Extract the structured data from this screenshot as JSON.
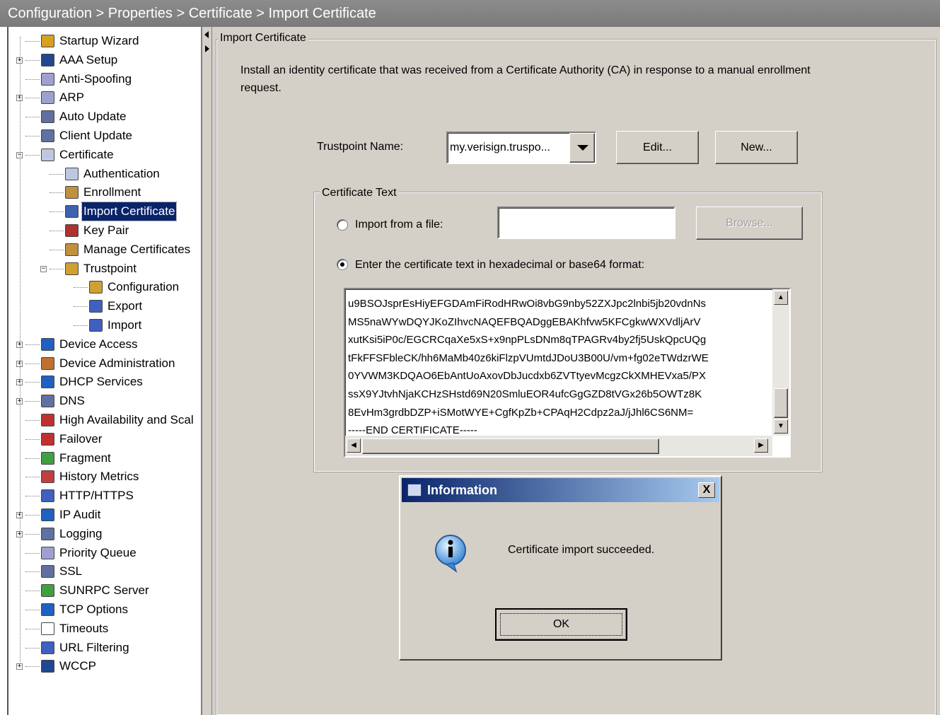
{
  "breadcrumb": "Configuration > Properties > Certificate > Import Certificate",
  "tree": [
    {
      "label": "Startup Wizard",
      "icon": "wizard-icon",
      "depth": 0,
      "expander": "",
      "color": "#d8a020"
    },
    {
      "label": "AAA Setup",
      "icon": "lock-icon",
      "depth": 0,
      "expander": "+",
      "color": "#204890"
    },
    {
      "label": "Anti-Spoofing",
      "icon": "shield-icon",
      "depth": 0,
      "expander": "",
      "color": "#a0a0d0"
    },
    {
      "label": "ARP",
      "icon": "table-icon",
      "depth": 0,
      "expander": "+",
      "color": "#a0a0d0"
    },
    {
      "label": "Auto Update",
      "icon": "computer-icon",
      "depth": 0,
      "expander": "",
      "color": "#6070a0"
    },
    {
      "label": "Client Update",
      "icon": "computer-icon",
      "depth": 0,
      "expander": "",
      "color": "#6070a0"
    },
    {
      "label": "Certificate",
      "icon": "certificate-icon",
      "depth": 0,
      "expander": "-",
      "color": "#c0c8e0"
    },
    {
      "label": "Authentication",
      "icon": "certificate-icon",
      "depth": 1,
      "expander": "",
      "color": "#c0c8e0"
    },
    {
      "label": "Enrollment",
      "icon": "users-icon",
      "depth": 1,
      "expander": "",
      "color": "#c09040"
    },
    {
      "label": "Import Certificate",
      "icon": "import-certificate-icon",
      "depth": 1,
      "expander": "",
      "color": "#4060b0",
      "selected": true
    },
    {
      "label": "Key Pair",
      "icon": "key-icon",
      "depth": 1,
      "expander": "",
      "color": "#b03030"
    },
    {
      "label": "Manage Certificates",
      "icon": "users-icon",
      "depth": 1,
      "expander": "",
      "color": "#c09040"
    },
    {
      "label": "Trustpoint",
      "icon": "trustpoint-icon",
      "depth": 1,
      "expander": "-",
      "color": "#d0a030"
    },
    {
      "label": "Configuration",
      "icon": "config-icon",
      "depth": 2,
      "expander": "",
      "color": "#d0a030"
    },
    {
      "label": "Export",
      "icon": "export-icon",
      "depth": 2,
      "expander": "",
      "color": "#4060c0"
    },
    {
      "label": "Import",
      "icon": "import-icon",
      "depth": 2,
      "expander": "",
      "color": "#4060c0"
    },
    {
      "label": "Device Access",
      "icon": "device-access-icon",
      "depth": 0,
      "expander": "+",
      "color": "#2060c0"
    },
    {
      "label": "Device Administration",
      "icon": "admin-icon",
      "depth": 0,
      "expander": "+",
      "color": "#c07030"
    },
    {
      "label": "DHCP Services",
      "icon": "dhcp-icon",
      "depth": 0,
      "expander": "+",
      "color": "#2060c0"
    },
    {
      "label": "DNS",
      "icon": "dns-icon",
      "depth": 0,
      "expander": "+",
      "color": "#6070a0"
    },
    {
      "label": "High Availability and Scal",
      "icon": "failover-icon",
      "depth": 0,
      "expander": "",
      "color": "#c03030"
    },
    {
      "label": "Failover",
      "icon": "failover-icon",
      "depth": 0,
      "expander": "",
      "color": "#c03030"
    },
    {
      "label": "Fragment",
      "icon": "fragment-icon",
      "depth": 0,
      "expander": "",
      "color": "#40a040"
    },
    {
      "label": "History Metrics",
      "icon": "metrics-icon",
      "depth": 0,
      "expander": "",
      "color": "#c04040"
    },
    {
      "label": "HTTP/HTTPS",
      "icon": "url-icon",
      "depth": 0,
      "expander": "",
      "color": "#4060c0"
    },
    {
      "label": "IP Audit",
      "icon": "audit-icon",
      "depth": 0,
      "expander": "+",
      "color": "#2060c0"
    },
    {
      "label": "Logging",
      "icon": "logging-icon",
      "depth": 0,
      "expander": "+",
      "color": "#6070a0"
    },
    {
      "label": "Priority Queue",
      "icon": "queue-icon",
      "depth": 0,
      "expander": "",
      "color": "#a0a0d0"
    },
    {
      "label": "SSL",
      "icon": "ssl-icon",
      "depth": 0,
      "expander": "",
      "color": "#6070a0"
    },
    {
      "label": "SUNRPC Server",
      "icon": "server-icon",
      "depth": 0,
      "expander": "",
      "color": "#40a040"
    },
    {
      "label": "TCP Options",
      "icon": "tcp-icon",
      "depth": 0,
      "expander": "",
      "color": "#2060c0"
    },
    {
      "label": "Timeouts",
      "icon": "clock-icon",
      "depth": 0,
      "expander": "",
      "color": "#ffffff"
    },
    {
      "label": "URL Filtering",
      "icon": "url-icon",
      "depth": 0,
      "expander": "",
      "color": "#4060c0"
    },
    {
      "label": "WCCP",
      "icon": "lock-icon",
      "depth": 0,
      "expander": "+",
      "color": "#204890"
    }
  ],
  "panel": {
    "group_title": "Import Certificate",
    "description": "Install an identity certificate that was received from a Certificate Authority (CA) in response to a manual enrollment request.",
    "trustpoint_label": "Trustpoint Name:",
    "trustpoint_value": "my.verisign.truspo...",
    "edit_button": "Edit...",
    "new_button": "New...",
    "cert_group_title": "Certificate Text",
    "radio_file_label": "Import from a file:",
    "file_path_value": "",
    "browse_button": "Browse...",
    "radio_text_label": "Enter the certificate text in hexadecimal or base64 format:",
    "cert_lines": [
      "u9BSOJsprEsHiyEFGDAmFiRodHRwOi8vbG9nby52ZXJpc2lnbi5jb20vdnNs",
      "MS5naWYwDQYJKoZIhvcNAQEFBQADggEBAKhfvw5KFCgkwWXVdljArV",
      "xutKsi5iP0c/EGCRCqaXe5xS+x9npPLsDNm8qTPAGRv4by2fj5UskQpcUQg",
      "tFkFFSFbleCK/hh6MaMb40z6kiFlzpVUmtdJDoU3B00U/vm+fg02eTWdzrWE",
      "0YVWM3KDQAO6EbAntUoAxovDbJucdxb6ZVTtyevMcgzCkXMHEVxa5/PX",
      "ssX9YJtvhNjaKCHzSHstd69N20SmluEOR4ufcGgGZD8tVGx26b5OWTz8K",
      "8EvHm3grdbDZP+iSMotWYE+CgfKpZb+CPAqH2Cdpz2aJ/jJhl6CS6NM=",
      "-----END CERTIFICATE-----"
    ]
  },
  "dialog": {
    "title": "Information",
    "message": "Certificate import succeeded.",
    "ok_button": "OK",
    "close_glyph": "X"
  }
}
